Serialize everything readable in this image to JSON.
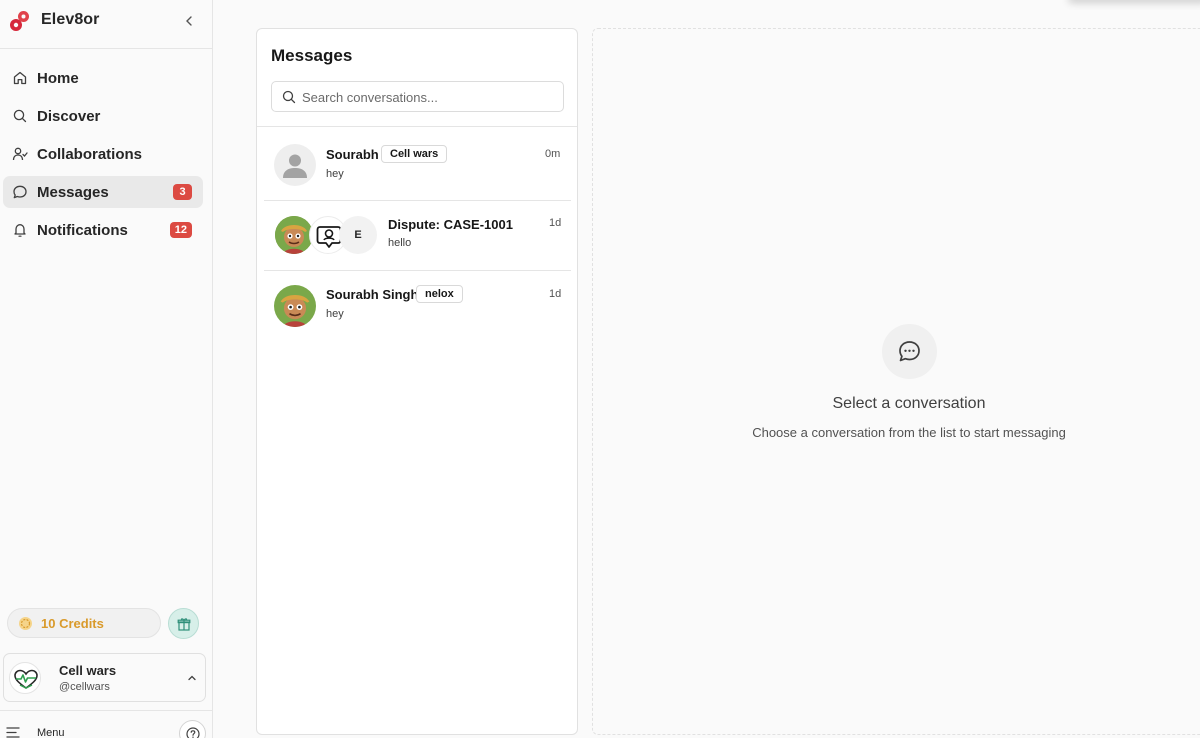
{
  "app": {
    "name": "Elev8or",
    "brand_color": "#e0424a"
  },
  "sidebar": {
    "items": [
      {
        "label": "Home",
        "icon": "home-icon",
        "badge": null
      },
      {
        "label": "Discover",
        "icon": "search-icon",
        "badge": null
      },
      {
        "label": "Collaborations",
        "icon": "users-icon",
        "badge": null
      },
      {
        "label": "Messages",
        "icon": "message-icon",
        "badge": "3",
        "active": true
      },
      {
        "label": "Notifications",
        "icon": "bell-icon",
        "badge": "12"
      }
    ],
    "credits_label": "10 Credits",
    "profile": {
      "name": "Cell wars",
      "handle": "@cellwars"
    },
    "menu_label": "Menu"
  },
  "messages": {
    "title": "Messages",
    "search_placeholder": "Search conversations...",
    "conversations": [
      {
        "name": "Sourabh",
        "tag": "Cell wars",
        "preview": "hey",
        "time": "0m",
        "avatar": "placeholder-avatar"
      },
      {
        "name": "Dispute: CASE-1001",
        "tag": null,
        "preview": "hello",
        "time": "1d",
        "avatar": "group-avatar",
        "initial": "E"
      },
      {
        "name": "Sourabh Singh",
        "tag": "nelox",
        "preview": "hey",
        "time": "1d",
        "avatar": "cartoon-avatar"
      }
    ]
  },
  "empty_state": {
    "title": "Select a conversation",
    "subtitle": "Choose a conversation from the list to start messaging"
  },
  "colors": {
    "badge": "#dc4a42",
    "credits": "#d99a2b",
    "active_nav": "#e9e9e9"
  }
}
